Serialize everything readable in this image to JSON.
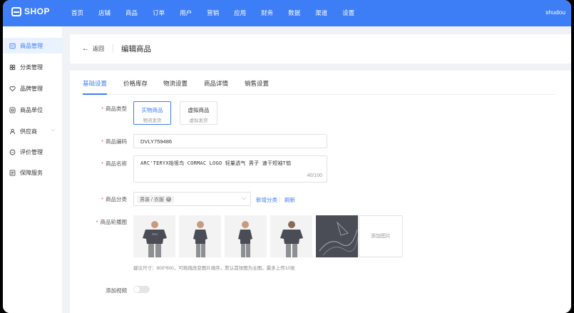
{
  "brand": {
    "name": "SHOP"
  },
  "nav": {
    "items": [
      "首页",
      "店铺",
      "商品",
      "订单",
      "用户",
      "营销",
      "应用",
      "财务",
      "数据",
      "渠道",
      "设置"
    ],
    "active_index": 2
  },
  "user": {
    "name": "shudou"
  },
  "sidebar": {
    "items": [
      {
        "label": "商品管理",
        "icon": "box-icon",
        "active": true
      },
      {
        "label": "分类管理",
        "icon": "grid-icon",
        "active": false
      },
      {
        "label": "品牌管理",
        "icon": "heart-icon",
        "active": false
      },
      {
        "label": "商品单位",
        "icon": "target-icon",
        "active": false
      },
      {
        "label": "供应商",
        "icon": "person-icon",
        "active": false,
        "has_caret": true
      },
      {
        "label": "评价管理",
        "icon": "chat-icon",
        "active": false
      },
      {
        "label": "保障服务",
        "icon": "list-icon",
        "active": false
      }
    ]
  },
  "header": {
    "back_label": "返回",
    "title": "编辑商品"
  },
  "tabs": {
    "items": [
      "基础设置",
      "价格库存",
      "物流设置",
      "商品详情",
      "销售设置"
    ],
    "active_index": 0
  },
  "form": {
    "type": {
      "label": "商品类型",
      "options": [
        {
          "title": "实物商品",
          "sub": "物流发货",
          "selected": true
        },
        {
          "title": "虚拟商品",
          "sub": "虚拟发货",
          "selected": false
        }
      ]
    },
    "code": {
      "label": "商品编码",
      "value": "DVLY759486"
    },
    "name": {
      "label": "商品名称",
      "value": "ARC'TERYX始祖鸟 CORMAC LOGO  轻量透气 男子 速干短袖T恤",
      "counter": "40/100"
    },
    "category": {
      "label": "商品分类",
      "tag": "男装 / 衣服",
      "add_link": "新增分类",
      "refresh_link": "刷新",
      "separator": "|"
    },
    "images": {
      "label": "商品轮播图",
      "add_label": "添加图片",
      "hint": "建议尺寸：800*800，可拖拽改变图片顺序，默认首张图为主图，最多上传10张"
    },
    "video": {
      "label": "添加视频",
      "enabled": false
    }
  },
  "colors": {
    "primary": "#3d7ef7",
    "required": "#e84b4b",
    "shirt": "#4a4d55"
  }
}
